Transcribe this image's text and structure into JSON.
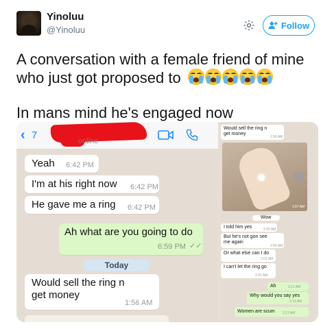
{
  "tweet": {
    "display_name": "Yinoluu",
    "handle": "@Yinoluu",
    "follow_label": "Follow",
    "text_line1": "A conversation with a female friend of mine who just got proposed to",
    "text_line2": "In mans mind he's engaged now"
  },
  "left_chat": {
    "back_count": "7",
    "status": "online",
    "messages": [
      {
        "text": "Yeah",
        "time": "6:42 PM",
        "direction": "in"
      },
      {
        "text": "I'm at his right now",
        "time": "6:42 PM",
        "direction": "in"
      },
      {
        "text": "He gave me a ring",
        "time": "6:42 PM",
        "direction": "in"
      },
      {
        "text": "Ah what are you going to do",
        "time": "6:59 PM",
        "direction": "out"
      },
      {
        "text": "Would sell the ring n get money",
        "time": "1:56 AM",
        "direction": "in"
      }
    ],
    "date_divider": "Today"
  },
  "right_chat": {
    "messages": [
      {
        "text": "Would sell the ring n get money",
        "time": "1:56 AM",
        "direction": "in"
      },
      {
        "text": "Wow",
        "time": "",
        "direction": "in"
      },
      {
        "text": "I told him yes",
        "time": "2:00 AM",
        "direction": "in"
      },
      {
        "text": "But he's not gon see me again",
        "time": "2:00 AM",
        "direction": "in"
      },
      {
        "text": "Or what else can I do",
        "time": "2:01 AM",
        "direction": "in"
      },
      {
        "text": "I can't let the ring go",
        "time": "2:01 AM",
        "direction": "in"
      },
      {
        "text": "Ah",
        "time": "2:12 AM",
        "direction": "out"
      },
      {
        "text": "Why would you say yes",
        "time": "2:13 AM",
        "direction": "out"
      },
      {
        "text": "Women are scum",
        "time": "2:13 AM",
        "direction": "out"
      }
    ],
    "photo_time": "1:57 AM"
  },
  "colors": {
    "twitter_blue": "#1da1f2",
    "ios_blue": "#1a87ff",
    "chat_bg": "#e5ddd3",
    "outgoing_bubble": "#dcf8c6",
    "redaction": "#e8121a"
  },
  "icons": [
    "gear-icon",
    "add-user-icon",
    "back-chevron-icon",
    "video-call-icon",
    "phone-icon",
    "crying-face-emoji",
    "share-icon"
  ]
}
